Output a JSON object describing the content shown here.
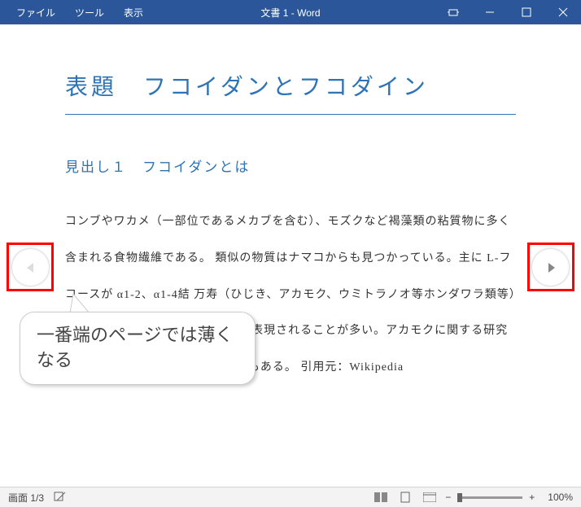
{
  "titlebar": {
    "menu": {
      "file": "ファイル",
      "tools": "ツール",
      "view": "表示"
    },
    "title": "文書 1  -  Word"
  },
  "document": {
    "title": "表題　フコイダンとフコダイン",
    "heading": "見出し１　フコイダンとは",
    "body": "コンブやワカメ（一部位であるメカブを含む）、モズクなど褐藻類の粘質物に多く含まれる食物繊維である。\n\n類似の物質はナマコからも見つかっている。主に L-フコースが α1-2、α1-4結 万寿（ひじき、アカモク、ウミトラノオ等ホンダワラ類等）に 段として海藻のネバネバ成分と表現されることが多い。アカモクに関する研究などから、生殖器に多いとの報告もある。\n\n引用元：Wikipedia"
  },
  "callout": {
    "text": "一番端のページでは薄くなる"
  },
  "statusbar": {
    "page": "画面 1/3",
    "zoom": "100%",
    "minus": "−",
    "plus": "+"
  }
}
